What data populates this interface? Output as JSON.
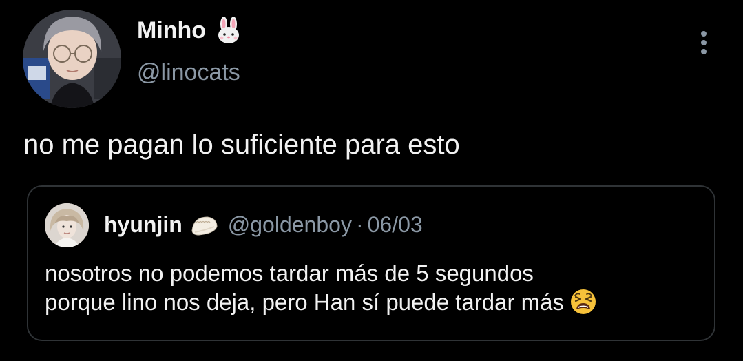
{
  "tweet": {
    "author": {
      "display_name": "Minho",
      "name_emoji": "rabbit-face-icon",
      "handle": "@linocats"
    },
    "text": "no me pagan lo suficiente para esto",
    "menu_icon": "more-vertical-icon"
  },
  "quote": {
    "author": {
      "display_name": "hyunjin",
      "name_emoji": "dumpling-icon",
      "handle": "@goldenboy"
    },
    "separator": "·",
    "date": "06/03",
    "lines": [
      "nosotros no podemos tardar más de 5 segundos",
      "porque lino nos deja, pero Han sí puede tardar más"
    ],
    "trailing_emoji": "weary-face-icon"
  },
  "colors": {
    "background": "#000000",
    "primary_text": "#f2f2f2",
    "secondary_text": "#8b98a5",
    "border": "#2f3336"
  }
}
